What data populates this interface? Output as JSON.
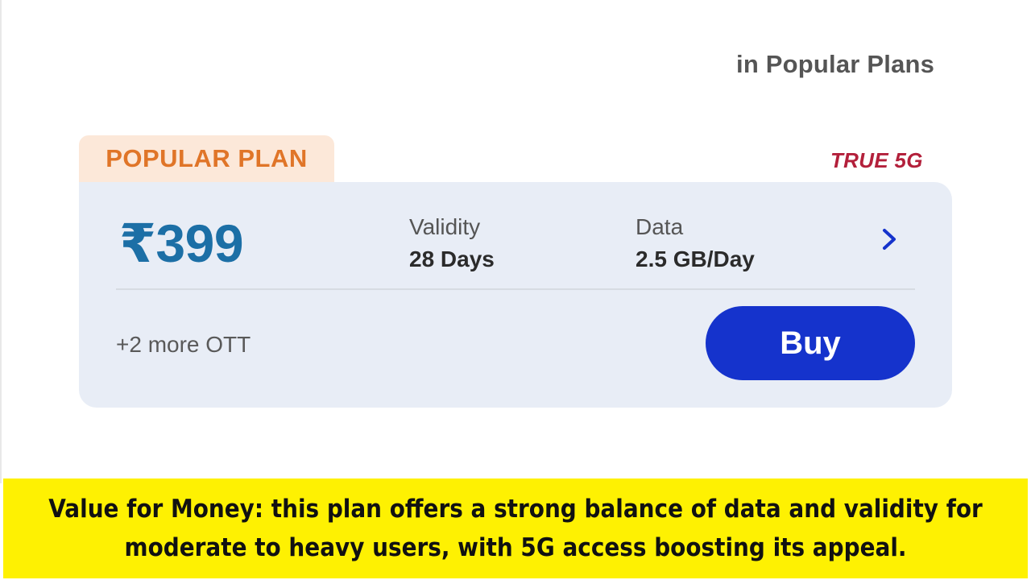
{
  "section": {
    "heading": "in Popular Plans"
  },
  "plan": {
    "badge": "POPULAR PLAN",
    "network_tag": "TRUE 5G",
    "price": "₹399",
    "validity_label": "Validity",
    "validity_value": "28 Days",
    "data_label": "Data",
    "data_value": "2.5 GB/Day",
    "ott_more": "+2 more OTT",
    "buy_label": "Buy",
    "details_icon": "chevron-right-icon"
  },
  "caption": {
    "text": "Value for Money: this plan offers a strong balance of data and validity for moderate to heavy users, with 5G access boosting its appeal."
  },
  "colors": {
    "badge_bg": "#fce8d9",
    "badge_text": "#e07528",
    "network_tag": "#b3203b",
    "card_bg": "#e8edf6",
    "price": "#1c6fa6",
    "buy_button": "#1533cc",
    "chevron": "#1533cc",
    "caption_bg": "#fef102"
  }
}
